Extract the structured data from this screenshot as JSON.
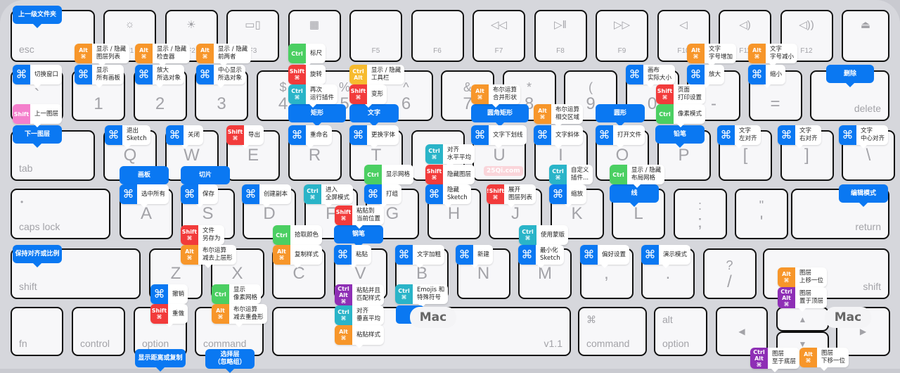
{
  "colors": {
    "blue": "#0a78f2",
    "orange": "#f7962a",
    "green": "#4bcf62",
    "red": "#f23b3b",
    "teal": "#2ab4c8",
    "yellow": "#f7bb2f",
    "purple": "#8e2fb5",
    "pink": "#f47fcc"
  },
  "keys": [
    {
      "main": "esc"
    },
    {
      "main": "F1",
      "icon": "brightness-down-icon"
    },
    {
      "main": "F2",
      "icon": "brightness-up-icon"
    },
    {
      "main": "F3",
      "icon": "mission-control-icon"
    },
    {
      "main": "F4",
      "icon": "launchpad-icon"
    },
    {
      "main": "F5"
    },
    {
      "main": "F6"
    },
    {
      "main": "F7",
      "icon": "rewind-icon"
    },
    {
      "main": "F8",
      "icon": "play-pause-icon"
    },
    {
      "main": "F9",
      "icon": "fast-forward-icon"
    },
    {
      "main": "F10",
      "icon": "mute-icon"
    },
    {
      "main": "F11",
      "icon": "volume-down-icon"
    },
    {
      "main": "F12",
      "icon": "volume-up-icon"
    },
    {
      "main": "",
      "icon": "eject-icon"
    },
    {
      "main": "`"
    },
    {
      "main": "1"
    },
    {
      "main": "2"
    },
    {
      "main": "3"
    },
    {
      "main": "4",
      "shift": "$"
    },
    {
      "main": "5",
      "shift": "%"
    },
    {
      "main": "6",
      "shift": "^"
    },
    {
      "main": "7",
      "shift": "&"
    },
    {
      "main": "8",
      "shift": "*"
    },
    {
      "main": "9",
      "shift": "("
    },
    {
      "main": "0"
    },
    {
      "main": "-"
    },
    {
      "main": "="
    },
    {
      "main": "delete"
    },
    {
      "main": "tab"
    },
    {
      "main": "Q"
    },
    {
      "main": "W"
    },
    {
      "main": "E"
    },
    {
      "main": "R"
    },
    {
      "main": "T"
    },
    {
      "main": "Y"
    },
    {
      "main": "U"
    },
    {
      "main": "I"
    },
    {
      "main": "O"
    },
    {
      "main": "P"
    },
    {
      "main": "["
    },
    {
      "main": "]"
    },
    {
      "main": "\\"
    },
    {
      "main": "caps lock"
    },
    {
      "main": "A"
    },
    {
      "main": "S"
    },
    {
      "main": "D"
    },
    {
      "main": "F"
    },
    {
      "main": "G"
    },
    {
      "main": "H"
    },
    {
      "main": "J"
    },
    {
      "main": "K"
    },
    {
      "main": "L"
    },
    {
      "main": ";",
      "shift": ":"
    },
    {
      "main": "'",
      "shift": "\""
    },
    {
      "main": "return"
    },
    {
      "main": "shift"
    },
    {
      "main": "Z"
    },
    {
      "main": "X"
    },
    {
      "main": "C"
    },
    {
      "main": "V"
    },
    {
      "main": "B"
    },
    {
      "main": "N"
    },
    {
      "main": "M"
    },
    {
      "main": ","
    },
    {
      "main": "."
    },
    {
      "main": "/",
      "shift": "?"
    },
    {
      "main": "shift"
    },
    {
      "main": "fn"
    },
    {
      "main": "control"
    },
    {
      "main": "option"
    },
    {
      "main": "command"
    },
    {
      "main": "v1.1"
    },
    {
      "main": "command",
      "shift": "⌘"
    },
    {
      "main": "option",
      "shift": "alt"
    },
    {
      "main": "◀"
    },
    {
      "main": "▲"
    },
    {
      "main": "▼"
    },
    {
      "main": "▶"
    }
  ],
  "callouts": [
    "上一级文件夹",
    "删除",
    "下一图层",
    "矩形",
    "文字",
    "圆角矩形",
    "圆形",
    "铅笔",
    "画板",
    "切片",
    "线",
    "编辑模式",
    "钢笔",
    "保持对齐或比例",
    "显示距离或复制",
    "选择层\n（忽略组）"
  ],
  "shortcuts": [
    {
      "mods": [
        "Alt",
        "⌘"
      ],
      "color": "orange",
      "text": [
        "显示 / 隐藏",
        "图层列表"
      ]
    },
    {
      "mods": [
        "Alt",
        "⌘"
      ],
      "color": "orange",
      "text": [
        "显示 / 隐藏",
        "检查器"
      ]
    },
    {
      "mods": [
        "Alt",
        "⌘"
      ],
      "color": "orange",
      "text": [
        "显示 / 隐藏",
        "前两者"
      ]
    },
    {
      "mods": [
        "⌘"
      ],
      "color": "blue",
      "text": [
        "切换窗口"
      ]
    },
    {
      "mods": [
        "⌘"
      ],
      "color": "blue",
      "text": [
        "显示",
        "所有画板"
      ]
    },
    {
      "mods": [
        "⌘"
      ],
      "color": "blue",
      "text": [
        "放大",
        "所选对象"
      ]
    },
    {
      "mods": [
        "⌘"
      ],
      "color": "blue",
      "text": [
        "中心显示",
        "所选对象"
      ]
    },
    {
      "mods": [
        "Shift"
      ],
      "color": "pink",
      "text": [
        "上一图层"
      ]
    },
    {
      "mods": [
        "Ctrl"
      ],
      "color": "green",
      "text": [
        "标尺"
      ]
    },
    {
      "mods": [
        "Shift",
        "⌘"
      ],
      "color": "red",
      "text": [
        "旋转"
      ]
    },
    {
      "mods": [
        "Ctrl",
        "⌘"
      ],
      "color": "teal",
      "text": [
        "再次",
        "运行插件"
      ]
    },
    {
      "mods": [
        "Ctrl",
        "Alt"
      ],
      "color": "yellow",
      "text": [
        "显示 / 隐藏",
        "工具栏"
      ]
    },
    {
      "mods": [
        "Shift",
        "⌘"
      ],
      "color": "red",
      "text": [
        "变形"
      ]
    },
    {
      "mods": [
        "Alt",
        "⌘"
      ],
      "color": "orange",
      "text": [
        "布尔运算",
        "合并形状"
      ]
    },
    {
      "mods": [
        "Alt",
        "⌘"
      ],
      "color": "orange",
      "text": [
        "布尔运算",
        "相交区域"
      ]
    },
    {
      "mods": [
        "⌘"
      ],
      "color": "blue",
      "text": [
        "画布",
        "实际大小"
      ]
    },
    {
      "mods": [
        "Alt",
        "⌘"
      ],
      "color": "orange",
      "text": [
        "文字",
        "字号增加"
      ]
    },
    {
      "mods": [
        "Alt",
        "⌘"
      ],
      "color": "orange",
      "text": [
        "文字",
        "字号减小"
      ]
    },
    {
      "mods": [
        "⌘"
      ],
      "color": "blue",
      "text": [
        "放大"
      ]
    },
    {
      "mods": [
        "⌘"
      ],
      "color": "blue",
      "text": [
        "缩小"
      ]
    },
    {
      "mods": [
        "Shift",
        "⌘"
      ],
      "color": "red",
      "text": [
        "页面",
        "打印设置"
      ]
    },
    {
      "mods": [
        "Ctrl"
      ],
      "color": "green",
      "text": [
        "像素模式"
      ]
    },
    {
      "mods": [
        "⌘"
      ],
      "color": "blue",
      "text": [
        "退出",
        "Sketch"
      ]
    },
    {
      "mods": [
        "⌘"
      ],
      "color": "blue",
      "text": [
        "关闭"
      ]
    },
    {
      "mods": [
        "Shift",
        "⌘"
      ],
      "color": "red",
      "text": [
        "导出"
      ]
    },
    {
      "mods": [
        "⌘"
      ],
      "color": "blue",
      "text": [
        "重命名"
      ]
    },
    {
      "mods": [
        "⌘"
      ],
      "color": "blue",
      "text": [
        "更换字体"
      ]
    },
    {
      "mods": [
        "⌘"
      ],
      "color": "blue",
      "text": [
        "文字下划线"
      ]
    },
    {
      "mods": [
        "⌘"
      ],
      "color": "blue",
      "text": [
        "文字斜体"
      ]
    },
    {
      "mods": [
        "⌘"
      ],
      "color": "blue",
      "text": [
        "打开文件"
      ]
    },
    {
      "mods": [
        "⌘"
      ],
      "color": "blue",
      "text": [
        "文字",
        "左对齐"
      ]
    },
    {
      "mods": [
        "⌘"
      ],
      "color": "blue",
      "text": [
        "文字",
        "右对齐"
      ]
    },
    {
      "mods": [
        "⌘"
      ],
      "color": "blue",
      "text": [
        "文字",
        "中心对齐"
      ]
    },
    {
      "mods": [
        "Ctrl",
        "⌘"
      ],
      "color": "teal",
      "text": [
        "对齐",
        "水平平均"
      ]
    },
    {
      "mods": [
        "Ctrl"
      ],
      "color": "green",
      "text": [
        "显示网格"
      ]
    },
    {
      "mods": [
        "Shift",
        "⌘"
      ],
      "color": "red",
      "text": [
        "隐藏图层"
      ]
    },
    {
      "mods": [
        "Ctrl",
        "⌘"
      ],
      "color": "teal",
      "text": [
        "自定义",
        "插件..."
      ]
    },
    {
      "mods": [
        "Ctrl"
      ],
      "color": "green",
      "text": [
        "显示 / 隐藏",
        "布局网格"
      ]
    },
    {
      "mods": [
        "⌘"
      ],
      "color": "blue",
      "text": [
        "选中所有"
      ]
    },
    {
      "mods": [
        "⌘"
      ],
      "color": "blue",
      "text": [
        "保存"
      ]
    },
    {
      "mods": [
        "⌘"
      ],
      "color": "blue",
      "text": [
        "创建副本"
      ]
    },
    {
      "mods": [
        "Ctrl",
        "⌘"
      ],
      "color": "teal",
      "text": [
        "进入",
        "全屏模式"
      ]
    },
    {
      "mods": [
        "⌘"
      ],
      "color": "blue",
      "text": [
        "打组"
      ]
    },
    {
      "mods": [
        "⌘"
      ],
      "color": "blue",
      "text": [
        "隐藏",
        "Sketch"
      ]
    },
    {
      "mods": [
        "!Shift",
        "⌘"
      ],
      "color": "red",
      "text": [
        "展开",
        "图层列表"
      ]
    },
    {
      "mods": [
        "⌘"
      ],
      "color": "blue",
      "text": [
        "缩放"
      ]
    },
    {
      "mods": [
        "Shift",
        "⌘"
      ],
      "color": "red",
      "text": [
        "粘贴到",
        "当前位置"
      ]
    },
    {
      "mods": [
        "Shift",
        "⌘"
      ],
      "color": "red",
      "text": [
        "文件",
        "另存为"
      ]
    },
    {
      "mods": [
        "Ctrl"
      ],
      "color": "green",
      "text": [
        "拾取颜色"
      ]
    },
    {
      "mods": [
        "Ctrl",
        "⌘"
      ],
      "color": "teal",
      "text": [
        "使用蒙版"
      ]
    },
    {
      "mods": [
        "Alt",
        "⌘"
      ],
      "color": "orange",
      "text": [
        "布尔运算",
        "减去上层形"
      ]
    },
    {
      "mods": [
        "Alt",
        "⌘"
      ],
      "color": "orange",
      "text": [
        "复制样式"
      ]
    },
    {
      "mods": [
        "⌘"
      ],
      "color": "blue",
      "text": [
        "粘贴"
      ]
    },
    {
      "mods": [
        "⌘"
      ],
      "color": "blue",
      "text": [
        "文字加粗"
      ]
    },
    {
      "mods": [
        "⌘"
      ],
      "color": "blue",
      "text": [
        "新建"
      ]
    },
    {
      "mods": [
        "⌘"
      ],
      "color": "blue",
      "text": [
        "最小化",
        "Sketch"
      ]
    },
    {
      "mods": [
        "⌘"
      ],
      "color": "blue",
      "text": [
        "偏好设置"
      ]
    },
    {
      "mods": [
        "⌘"
      ],
      "color": "blue",
      "text": [
        "演示模式"
      ]
    },
    {
      "mods": [
        "⌘"
      ],
      "color": "blue",
      "text": [
        "撤销"
      ]
    },
    {
      "mods": [
        "Ctrl"
      ],
      "color": "green",
      "text": [
        "显示",
        "像素网格"
      ]
    },
    {
      "mods": [
        "Ctrl",
        "Alt",
        "⌘"
      ],
      "color": "purple",
      "text": [
        "粘贴并且",
        "匹配样式"
      ]
    },
    {
      "mods": [
        "Ctrl",
        "⌘"
      ],
      "color": "teal",
      "text": [
        "Emojis 和",
        "特殊符号"
      ]
    },
    {
      "mods": [
        "Shift",
        "⌘"
      ],
      "color": "red",
      "text": [
        "重做"
      ]
    },
    {
      "mods": [
        "Alt",
        "⌘"
      ],
      "color": "orange",
      "text": [
        "布尔运算",
        "减去重叠形"
      ]
    },
    {
      "mods": [
        "Ctrl",
        "⌘"
      ],
      "color": "teal",
      "text": [
        "对齐",
        "垂直平均"
      ]
    },
    {
      "mods": [
        "Alt",
        "⌘"
      ],
      "color": "orange",
      "text": [
        "粘贴样式"
      ]
    },
    {
      "mods": [
        "Alt",
        "⌘"
      ],
      "color": "orange",
      "text": [
        "图层",
        "上移一位"
      ]
    },
    {
      "mods": [
        "Ctrl",
        "Alt",
        "⌘"
      ],
      "color": "purple",
      "text": [
        "图层",
        "置于顶层"
      ]
    },
    {
      "mods": [
        "Ctrl",
        "Alt",
        "⌘"
      ],
      "color": "purple",
      "text": [
        "图层",
        "至于底层"
      ]
    },
    {
      "mods": [
        "Alt",
        "⌘"
      ],
      "color": "orange",
      "text": [
        "图层",
        "下移一位"
      ]
    }
  ],
  "mac_labels": [
    "Mac",
    "Mac"
  ],
  "watermark": "25Qi.com"
}
